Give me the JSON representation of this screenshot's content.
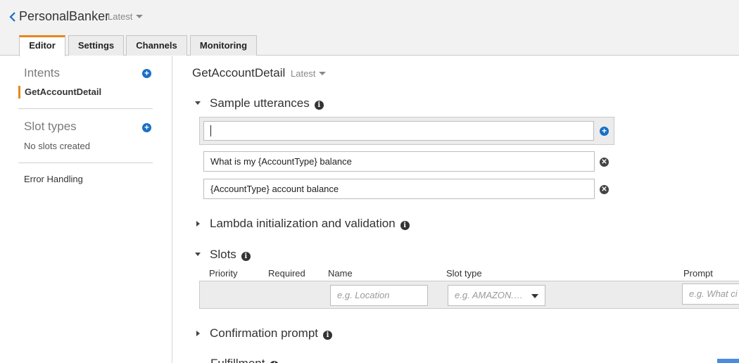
{
  "header": {
    "back_icon": "chevron-left-icon",
    "title": "PersonalBanker",
    "version": "Latest",
    "tabs": [
      {
        "label": "Editor",
        "active": true
      },
      {
        "label": "Settings",
        "active": false
      },
      {
        "label": "Channels",
        "active": false
      },
      {
        "label": "Monitoring",
        "active": false
      }
    ]
  },
  "sidebar": {
    "intents_heading": "Intents",
    "intents": [
      {
        "label": "GetAccountDetail",
        "selected": true
      }
    ],
    "slot_types_heading": "Slot types",
    "slot_types_empty": "No slots created",
    "error_handling": "Error Handling"
  },
  "main": {
    "intent_name": "GetAccountDetail",
    "version": "Latest",
    "sample_utterances": {
      "heading": "Sample utterances",
      "input_value": "",
      "items": [
        "What is my {AccountType} balance",
        "{AccountType} account balance"
      ]
    },
    "lambda": {
      "heading": "Lambda initialization and validation"
    },
    "slots": {
      "heading": "Slots",
      "columns": [
        "Priority",
        "Required",
        "Name",
        "Slot type",
        "Prompt"
      ],
      "name_placeholder": "e.g. Location",
      "slot_type_placeholder": "e.g. AMAZON.…",
      "prompt_placeholder": "e.g. What ci"
    },
    "confirmation": {
      "heading": "Confirmation prompt"
    },
    "fulfillment": {
      "heading": "Fulfillment"
    }
  },
  "colors": {
    "accent_orange": "#e8871e",
    "add_blue": "#1a6fc4",
    "header_bg": "#f2f2f2"
  }
}
